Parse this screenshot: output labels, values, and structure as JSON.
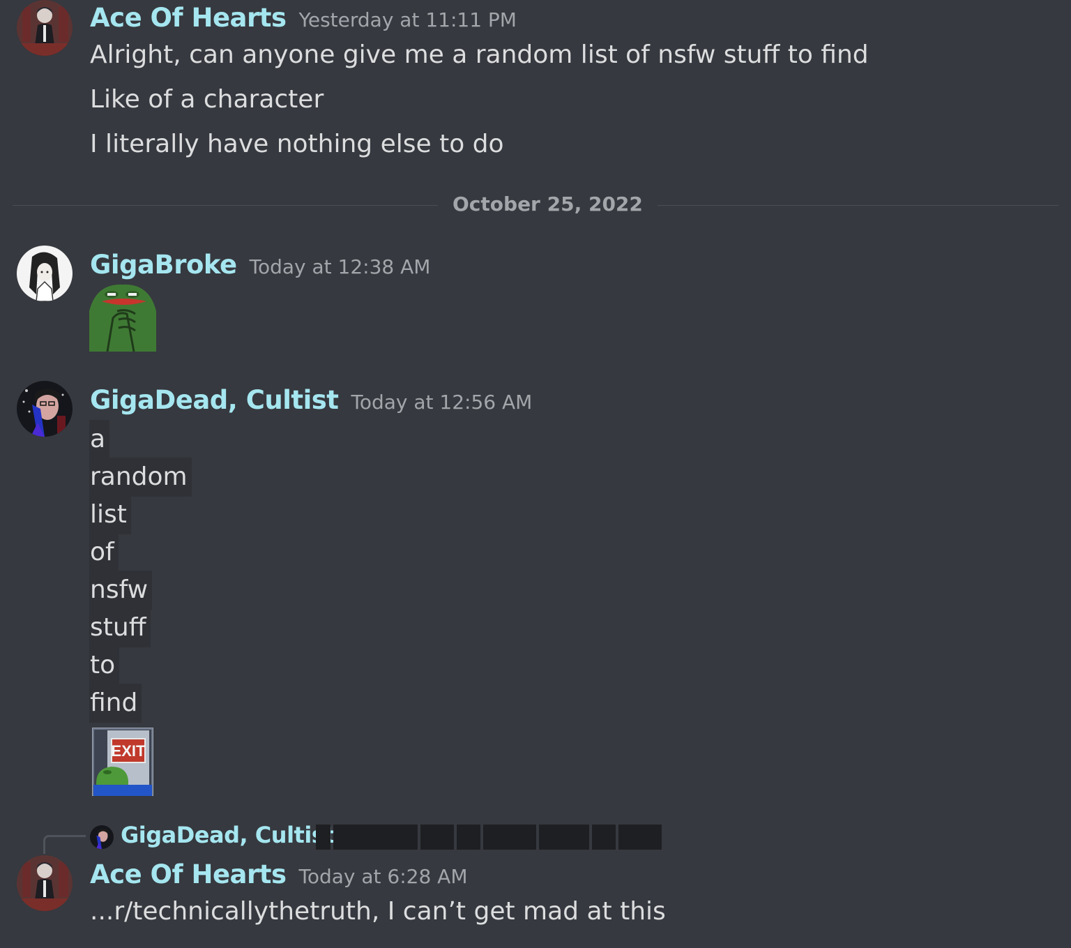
{
  "messages": [
    {
      "author": "Ace Of Hearts",
      "timestamp": "Yesterday at 11:11 PM",
      "lines": [
        "Alright, can anyone give me a random list of nsfw stuff to find",
        "Like of a character",
        "I literally have nothing else to do"
      ]
    },
    {
      "author": "GigaBroke",
      "timestamp": "Today at 12:38 AM",
      "attachment": "pepe-emote"
    },
    {
      "author": "GigaDead, Cultist",
      "timestamp": "Today at 12:56 AM",
      "spoiler_words": [
        "a",
        "random",
        "list",
        "of",
        "nsfw",
        "stuff",
        "to",
        "find"
      ],
      "attachment": "pepe-exit-emote",
      "exit_sign": "EXIT"
    },
    {
      "author": "Ace Of Hearts",
      "timestamp": "Today at 6:28 AM",
      "reply_to": "GigaDead, Cultist",
      "lines": [
        "...r/technicallythetruth, I can’t get mad at this"
      ]
    }
  ],
  "date_divider": "October 25, 2022",
  "colors": {
    "background": "#36393f",
    "username": "#a5e6f0",
    "text": "#dcddde",
    "muted": "#a3a6aa",
    "spoiler_bg": "#2f3136"
  }
}
